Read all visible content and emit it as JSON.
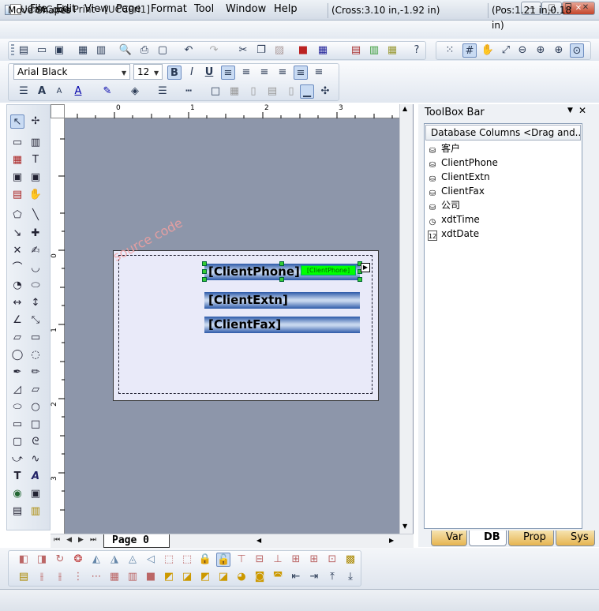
{
  "window": {
    "title": "UCanCode Print - [UCCPri1]"
  },
  "menu": [
    "File",
    "Edit",
    "View",
    "Page",
    "Format",
    "Tool",
    "Window",
    "Help"
  ],
  "font": {
    "name": "Arial Black",
    "size": "12"
  },
  "ruler": {
    "top": [
      "0",
      "1",
      "2",
      "3"
    ],
    "left": [
      "0",
      "1",
      "2",
      "3"
    ]
  },
  "canvas": {
    "watermark": "source code",
    "fields": {
      "phone": "[ClientPhone]",
      "phone_tag": "[ClientPhone]",
      "ext": "[ClientExtn]",
      "fax": "[ClientFax]"
    }
  },
  "page_tab": "Page  0",
  "toolbox": {
    "title": "ToolBox Bar",
    "header": "Database Columns <Drag and...",
    "items": [
      {
        "label": "客户",
        "icon": "database-icon"
      },
      {
        "label": "ClientPhone",
        "icon": "database-icon"
      },
      {
        "label": "ClientExtn",
        "icon": "database-icon"
      },
      {
        "label": "ClientFax",
        "icon": "database-icon"
      },
      {
        "label": "公司",
        "icon": "database-icon"
      },
      {
        "label": "xdtTime",
        "icon": "clock-icon"
      },
      {
        "label": "xdtDate",
        "icon": "calendar-icon"
      }
    ],
    "tabs": [
      "Var",
      "DB",
      "Prop",
      "Sys"
    ]
  },
  "status": {
    "message": "Move Shapes",
    "cross": "(Cross:3.10 in,-1.92 in)",
    "pos": "(Pos:1.21 in,0.18 in)"
  }
}
